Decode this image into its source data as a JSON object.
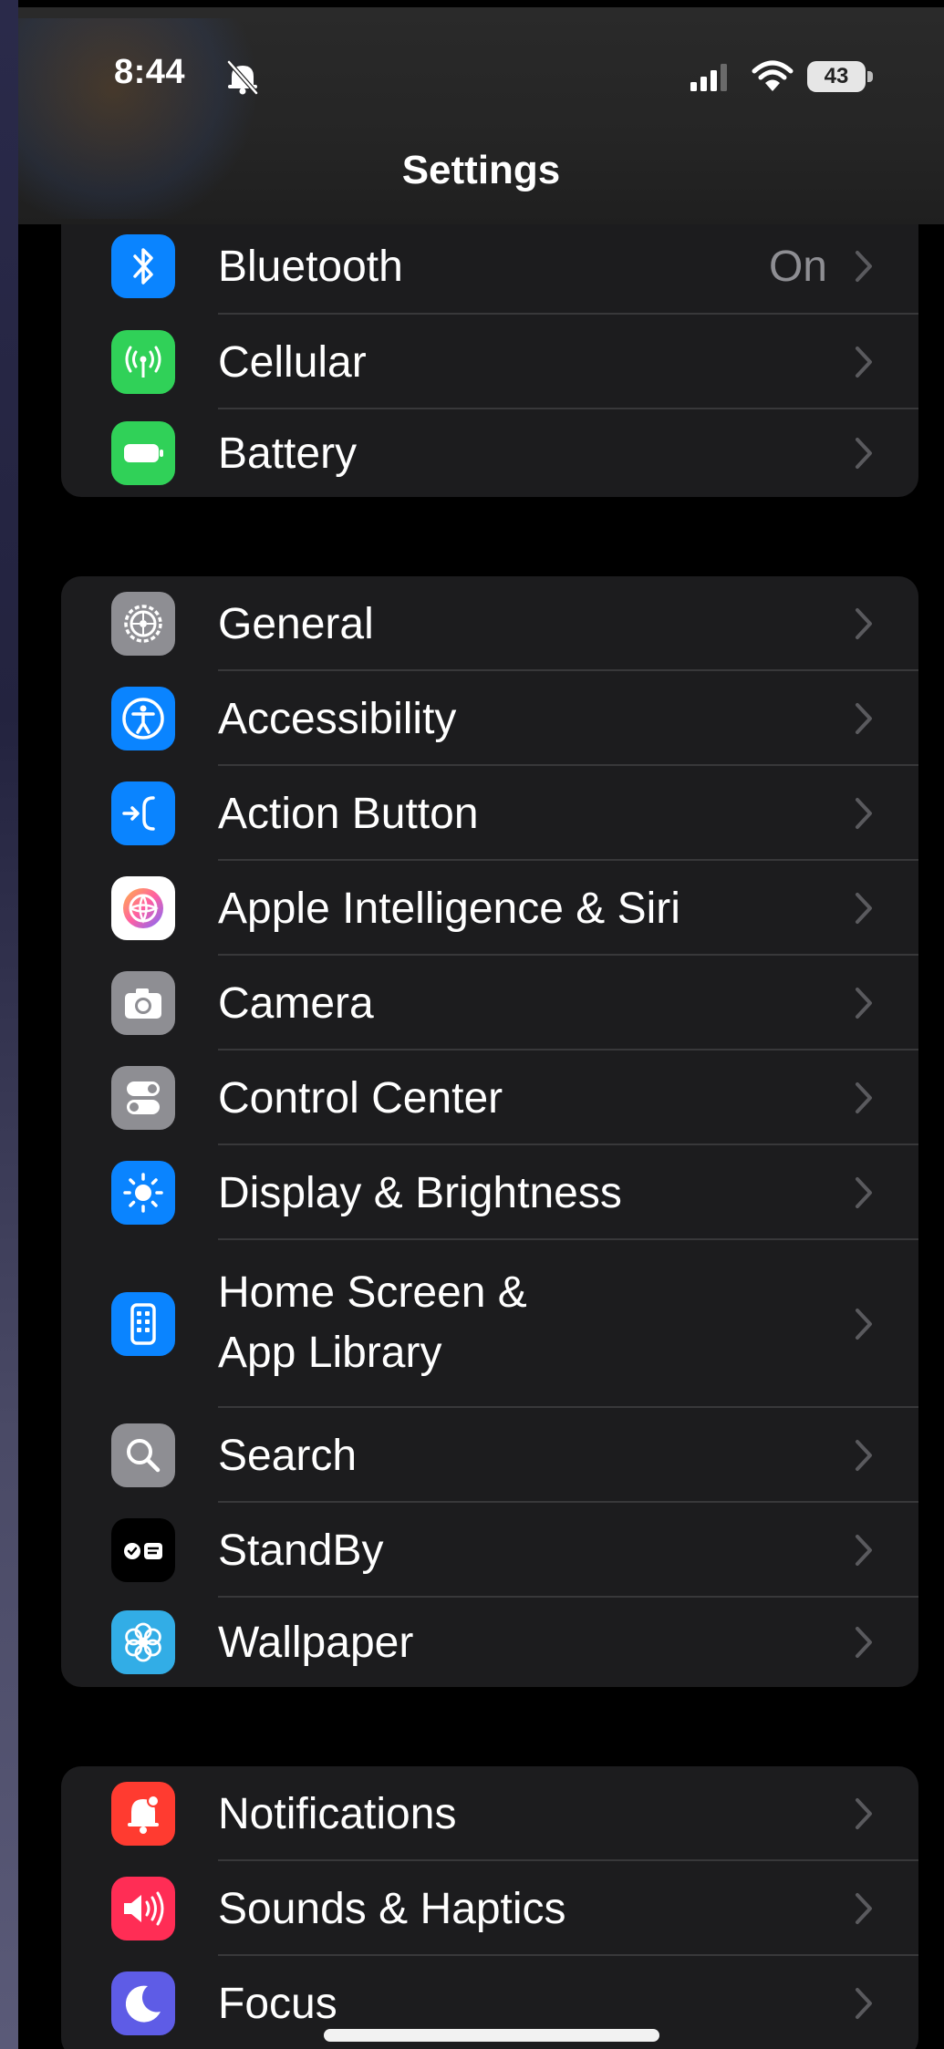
{
  "status_bar": {
    "time": "8:44",
    "battery_percent": "43",
    "icons": [
      "bell-slash-icon",
      "cellular-signal-icon",
      "wifi-icon",
      "battery-icon"
    ]
  },
  "header": {
    "title": "Settings"
  },
  "groups": [
    {
      "items": [
        {
          "label": "Bluetooth",
          "value": "On",
          "icon": "bluetooth-icon",
          "icon_color": "#0a84ff"
        },
        {
          "label": "Cellular",
          "icon": "cellular-antenna-icon",
          "icon_color": "#30d158"
        },
        {
          "label": "Battery",
          "icon": "battery-icon",
          "icon_color": "#30d158"
        }
      ]
    },
    {
      "items": [
        {
          "label": "General",
          "icon": "gear-icon",
          "icon_color": "#8e8e93"
        },
        {
          "label": "Accessibility",
          "icon": "accessibility-icon",
          "icon_color": "#0a84ff"
        },
        {
          "label": "Action Button",
          "icon": "action-button-icon",
          "icon_color": "#0a84ff"
        },
        {
          "label": "Apple Intelligence & Siri",
          "icon": "apple-intelligence-icon",
          "icon_color": "#ff6b9d"
        },
        {
          "label": "Camera",
          "icon": "camera-icon",
          "icon_color": "#8e8e93"
        },
        {
          "label": "Control Center",
          "icon": "control-center-icon",
          "icon_color": "#8e8e93"
        },
        {
          "label": "Display & Brightness",
          "icon": "brightness-icon",
          "icon_color": "#0a84ff"
        },
        {
          "label": "Home Screen &\nApp Library",
          "icon": "home-screen-icon",
          "icon_color": "#0a84ff"
        },
        {
          "label": "Search",
          "icon": "search-icon",
          "icon_color": "#8e8e93"
        },
        {
          "label": "StandBy",
          "icon": "standby-icon",
          "icon_color": "#000000"
        },
        {
          "label": "Wallpaper",
          "icon": "wallpaper-flower-icon",
          "icon_color": "#32ade6"
        }
      ]
    },
    {
      "items": [
        {
          "label": "Notifications",
          "icon": "notifications-icon",
          "icon_color": "#ff3b30"
        },
        {
          "label": "Sounds & Haptics",
          "icon": "speaker-icon",
          "icon_color": "#ff2d55"
        },
        {
          "label": "Focus",
          "icon": "moon-icon",
          "icon_color": "#5e5ce6"
        }
      ]
    }
  ]
}
